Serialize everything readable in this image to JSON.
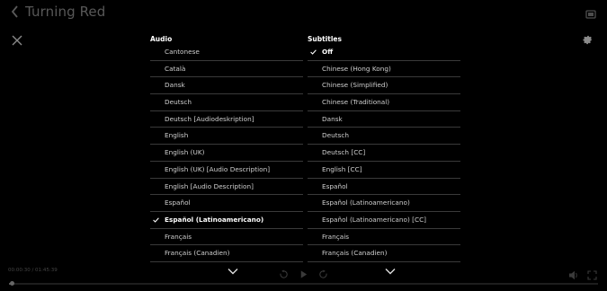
{
  "header": {
    "title": "Turning Red"
  },
  "audio": {
    "header": "Audio",
    "selected_index": 10,
    "items": [
      "Cantonese",
      "Català",
      "Dansk",
      "Deutsch",
      "Deutsch [Audiodeskription]",
      "English",
      "English (UK)",
      "English (UK) [Audio Description]",
      "English [Audio Description]",
      "Español",
      "Español (Latinoamericano)",
      "Français",
      "Français (Canadien)"
    ]
  },
  "subtitles": {
    "header": "Subtitles",
    "selected_index": 0,
    "items": [
      "Off",
      "Chinese (Hong Kong)",
      "Chinese (Simplified)",
      "Chinese (Traditional)",
      "Dansk",
      "Deutsch",
      "Deutsch [CC]",
      "English [CC]",
      "Español",
      "Español (Latinoamericano)",
      "Español (Latinoamericano) [CC]",
      "Français",
      "Français (Canadien)"
    ]
  },
  "player": {
    "time": "00:00:30 / 01:45:39",
    "progress_fraction": 0.005
  },
  "icons": {
    "back": "chevron-left-icon",
    "cast": "cast-icon",
    "close": "close-icon",
    "settings": "gear-icon",
    "rewind": "rewind-10-icon",
    "play": "play-icon",
    "forward": "forward-10-icon",
    "volume": "volume-icon",
    "fullscreen": "fullscreen-icon",
    "check": "check-icon",
    "scroll": "chevron-down-icon"
  },
  "colors": {
    "background": "#000000",
    "text": "#ffffff",
    "muted_text": "#cfcfcf",
    "divider": "#3a3a3a"
  }
}
